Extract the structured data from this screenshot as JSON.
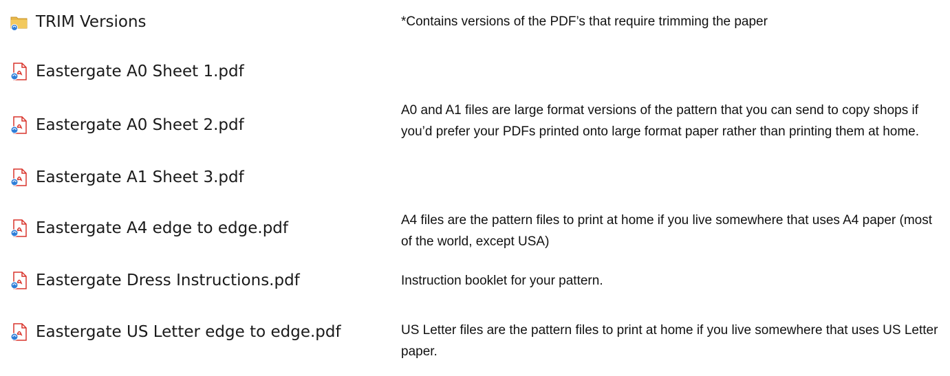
{
  "files": [
    {
      "label": "TRIM Versions",
      "icon": "folder-sync-icon",
      "type": "folder"
    },
    {
      "label": "Eastergate A0 Sheet 1.pdf",
      "icon": "pdf-sync-icon",
      "type": "pdf"
    },
    {
      "label": "Eastergate A0 Sheet 2.pdf",
      "icon": "pdf-sync-icon",
      "type": "pdf"
    },
    {
      "label": "Eastergate A1 Sheet 3.pdf",
      "icon": "pdf-sync-icon",
      "type": "pdf"
    },
    {
      "label": "Eastergate A4 edge to edge.pdf",
      "icon": "pdf-sync-icon",
      "type": "pdf"
    },
    {
      "label": "Eastergate Dress Instructions.pdf",
      "icon": "pdf-sync-icon",
      "type": "pdf"
    },
    {
      "label": "Eastergate US Letter edge to edge.pdf",
      "icon": "pdf-sync-icon",
      "type": "pdf"
    }
  ],
  "descriptions": {
    "trim": "*Contains versions of the PDF’s that require trimming the paper",
    "large_format": "A0 and A1 files are large format versions of the pattern that you can send to copy shops if you’d prefer your PDFs printed onto large format paper rather than printing them at home.",
    "a4": "A4 files are the pattern files to print at home if you live somewhere that uses A4 paper (most of the world, except USA)",
    "instructions": "Instruction booklet for your pattern.",
    "us_letter": "US Letter files are the pattern files to print at home if you live somewhere that uses US Letter paper."
  },
  "colors": {
    "folder": "#e8b84a",
    "folder_dark": "#d19a2a",
    "pdf_red": "#d9342b",
    "sync_blue": "#2f7ed8"
  }
}
